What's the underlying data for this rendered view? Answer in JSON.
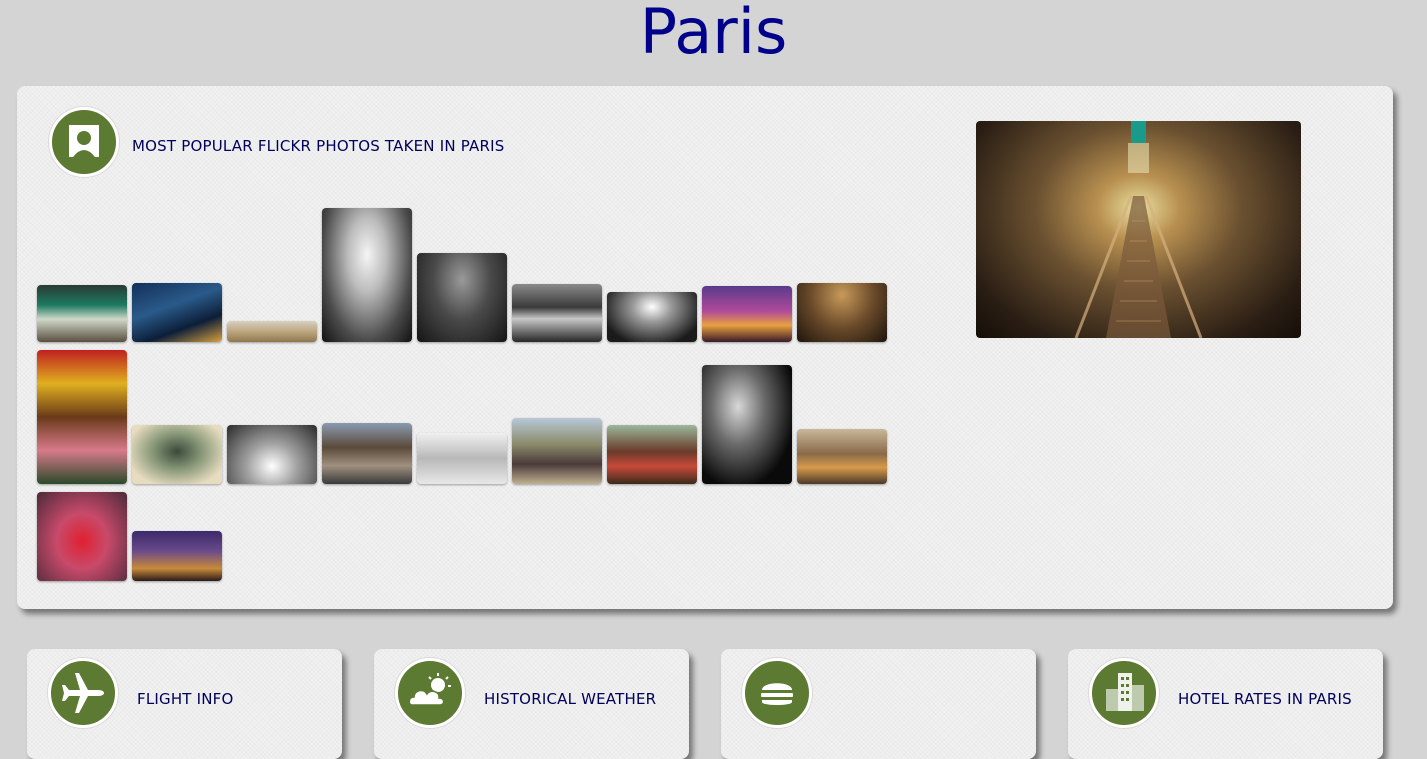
{
  "page": {
    "title": "Paris"
  },
  "flickr": {
    "heading": "MOST POPULAR FLICKR PHOTOS TAKEN IN PARIS",
    "icon": "portrait-icon",
    "accent_color": "#5c7a32"
  },
  "cards": [
    {
      "label": "FLIGHT INFO",
      "icon": "airplane-icon"
    },
    {
      "label": "HISTORICAL WEATHER",
      "icon": "cloud-sun-icon"
    },
    {
      "label": "",
      "icon": "burger-icon"
    },
    {
      "label": "HOTEL RATES IN PARIS",
      "icon": "buildings-icon"
    }
  ]
}
